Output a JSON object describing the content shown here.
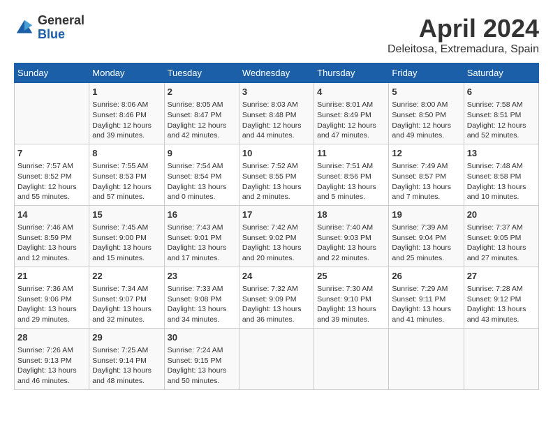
{
  "logo": {
    "general": "General",
    "blue": "Blue"
  },
  "title": {
    "month_year": "April 2024",
    "location": "Deleitosa, Extremadura, Spain"
  },
  "days_of_week": [
    "Sunday",
    "Monday",
    "Tuesday",
    "Wednesday",
    "Thursday",
    "Friday",
    "Saturday"
  ],
  "weeks": [
    [
      {
        "day": "",
        "content": ""
      },
      {
        "day": "1",
        "content": "Sunrise: 8:06 AM\nSunset: 8:46 PM\nDaylight: 12 hours\nand 39 minutes."
      },
      {
        "day": "2",
        "content": "Sunrise: 8:05 AM\nSunset: 8:47 PM\nDaylight: 12 hours\nand 42 minutes."
      },
      {
        "day": "3",
        "content": "Sunrise: 8:03 AM\nSunset: 8:48 PM\nDaylight: 12 hours\nand 44 minutes."
      },
      {
        "day": "4",
        "content": "Sunrise: 8:01 AM\nSunset: 8:49 PM\nDaylight: 12 hours\nand 47 minutes."
      },
      {
        "day": "5",
        "content": "Sunrise: 8:00 AM\nSunset: 8:50 PM\nDaylight: 12 hours\nand 49 minutes."
      },
      {
        "day": "6",
        "content": "Sunrise: 7:58 AM\nSunset: 8:51 PM\nDaylight: 12 hours\nand 52 minutes."
      }
    ],
    [
      {
        "day": "7",
        "content": "Sunrise: 7:57 AM\nSunset: 8:52 PM\nDaylight: 12 hours\nand 55 minutes."
      },
      {
        "day": "8",
        "content": "Sunrise: 7:55 AM\nSunset: 8:53 PM\nDaylight: 12 hours\nand 57 minutes."
      },
      {
        "day": "9",
        "content": "Sunrise: 7:54 AM\nSunset: 8:54 PM\nDaylight: 13 hours\nand 0 minutes."
      },
      {
        "day": "10",
        "content": "Sunrise: 7:52 AM\nSunset: 8:55 PM\nDaylight: 13 hours\nand 2 minutes."
      },
      {
        "day": "11",
        "content": "Sunrise: 7:51 AM\nSunset: 8:56 PM\nDaylight: 13 hours\nand 5 minutes."
      },
      {
        "day": "12",
        "content": "Sunrise: 7:49 AM\nSunset: 8:57 PM\nDaylight: 13 hours\nand 7 minutes."
      },
      {
        "day": "13",
        "content": "Sunrise: 7:48 AM\nSunset: 8:58 PM\nDaylight: 13 hours\nand 10 minutes."
      }
    ],
    [
      {
        "day": "14",
        "content": "Sunrise: 7:46 AM\nSunset: 8:59 PM\nDaylight: 13 hours\nand 12 minutes."
      },
      {
        "day": "15",
        "content": "Sunrise: 7:45 AM\nSunset: 9:00 PM\nDaylight: 13 hours\nand 15 minutes."
      },
      {
        "day": "16",
        "content": "Sunrise: 7:43 AM\nSunset: 9:01 PM\nDaylight: 13 hours\nand 17 minutes."
      },
      {
        "day": "17",
        "content": "Sunrise: 7:42 AM\nSunset: 9:02 PM\nDaylight: 13 hours\nand 20 minutes."
      },
      {
        "day": "18",
        "content": "Sunrise: 7:40 AM\nSunset: 9:03 PM\nDaylight: 13 hours\nand 22 minutes."
      },
      {
        "day": "19",
        "content": "Sunrise: 7:39 AM\nSunset: 9:04 PM\nDaylight: 13 hours\nand 25 minutes."
      },
      {
        "day": "20",
        "content": "Sunrise: 7:37 AM\nSunset: 9:05 PM\nDaylight: 13 hours\nand 27 minutes."
      }
    ],
    [
      {
        "day": "21",
        "content": "Sunrise: 7:36 AM\nSunset: 9:06 PM\nDaylight: 13 hours\nand 29 minutes."
      },
      {
        "day": "22",
        "content": "Sunrise: 7:34 AM\nSunset: 9:07 PM\nDaylight: 13 hours\nand 32 minutes."
      },
      {
        "day": "23",
        "content": "Sunrise: 7:33 AM\nSunset: 9:08 PM\nDaylight: 13 hours\nand 34 minutes."
      },
      {
        "day": "24",
        "content": "Sunrise: 7:32 AM\nSunset: 9:09 PM\nDaylight: 13 hours\nand 36 minutes."
      },
      {
        "day": "25",
        "content": "Sunrise: 7:30 AM\nSunset: 9:10 PM\nDaylight: 13 hours\nand 39 minutes."
      },
      {
        "day": "26",
        "content": "Sunrise: 7:29 AM\nSunset: 9:11 PM\nDaylight: 13 hours\nand 41 minutes."
      },
      {
        "day": "27",
        "content": "Sunrise: 7:28 AM\nSunset: 9:12 PM\nDaylight: 13 hours\nand 43 minutes."
      }
    ],
    [
      {
        "day": "28",
        "content": "Sunrise: 7:26 AM\nSunset: 9:13 PM\nDaylight: 13 hours\nand 46 minutes."
      },
      {
        "day": "29",
        "content": "Sunrise: 7:25 AM\nSunset: 9:14 PM\nDaylight: 13 hours\nand 48 minutes."
      },
      {
        "day": "30",
        "content": "Sunrise: 7:24 AM\nSunset: 9:15 PM\nDaylight: 13 hours\nand 50 minutes."
      },
      {
        "day": "",
        "content": ""
      },
      {
        "day": "",
        "content": ""
      },
      {
        "day": "",
        "content": ""
      },
      {
        "day": "",
        "content": ""
      }
    ]
  ]
}
